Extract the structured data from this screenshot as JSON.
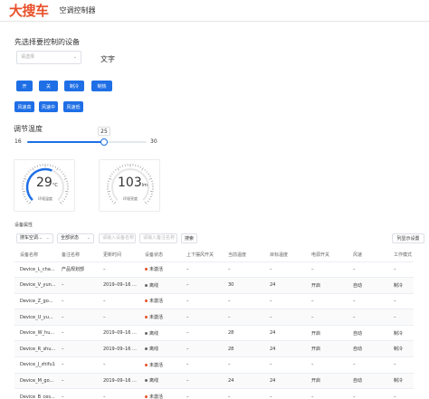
{
  "header": {
    "logo": "大搜车",
    "title": "空调控制器"
  },
  "control": {
    "section_title": "先选择要控制的设备",
    "select_placeholder": "请选择",
    "text_label": "文字"
  },
  "buttons": {
    "on": "开",
    "off": "关",
    "cool": "制冷",
    "heat": "制热",
    "wind_high": "风速高",
    "wind_mid": "风速中",
    "wind_low": "风速低"
  },
  "slider": {
    "title": "调节温度",
    "value": 25,
    "min": 16,
    "max": 30,
    "fill_color": "#1e6fe6"
  },
  "gauges": [
    {
      "value": "29",
      "unit": "°C",
      "label": "环境温度",
      "level": 0.58,
      "color": "#1e6fe6"
    },
    {
      "value": "103",
      "unit": "lm",
      "label": "环境亮度",
      "level": 0.0,
      "color": "#1e6fe6"
    }
  ],
  "props": {
    "title": "设备属性",
    "filter_product": "搜车空调...",
    "filter_status": "全部状态",
    "filter_device_placeholder": "请输入设备名称",
    "filter_remark_placeholder": "请输入备注名称",
    "search_label": "搜索",
    "column_settings_label": "列显示设置"
  },
  "table": {
    "columns": [
      "设备名称",
      "备注名称",
      "更新时间",
      "设备状态",
      "上下摆风开关",
      "当前温度",
      "目标温度",
      "电源开关",
      "风速",
      "工作模式"
    ],
    "rows": [
      [
        "Device_L_cha...",
        "产品规划部",
        "–",
        "未激活",
        "–",
        "–",
        "–",
        "–",
        "–",
        "–"
      ],
      [
        "Device_V_yun...",
        "–",
        "2019–09–16 ...",
        "离线",
        "–",
        "30",
        "24",
        "开启",
        "自动",
        "制冷"
      ],
      [
        "Device_Z_go...",
        "–",
        "–",
        "未激活",
        "–",
        "–",
        "–",
        "–",
        "–",
        "–"
      ],
      [
        "Device_U_yu...",
        "–",
        "–",
        "未激活",
        "–",
        "–",
        "–",
        "–",
        "–",
        "–"
      ],
      [
        "Device_W_hu...",
        "–",
        "2019–09–16 ...",
        "离线",
        "–",
        "28",
        "24",
        "开启",
        "自动",
        "制冷"
      ],
      [
        "Device_R_shu...",
        "–",
        "2019–09–16 ...",
        "离线",
        "–",
        "28",
        "24",
        "开启",
        "自动",
        "制冷"
      ],
      [
        "Device_J_zhifu1",
        "–",
        "–",
        "未激活",
        "–",
        "–",
        "–",
        "–",
        "–",
        "–"
      ],
      [
        "Device_M_go...",
        "–",
        "2019–09–16 ...",
        "离线",
        "–",
        "24",
        "24",
        "开启",
        "自动",
        "制冷"
      ],
      [
        "Device_B_ces...",
        "–",
        "–",
        "未激活",
        "–",
        "–",
        "–",
        "–",
        "–",
        "–"
      ]
    ],
    "status_colors": {
      "未激活": "#e8502a",
      "离线": "#666666"
    }
  },
  "icons": {
    "select_chevron": "chevron-down-icon"
  }
}
